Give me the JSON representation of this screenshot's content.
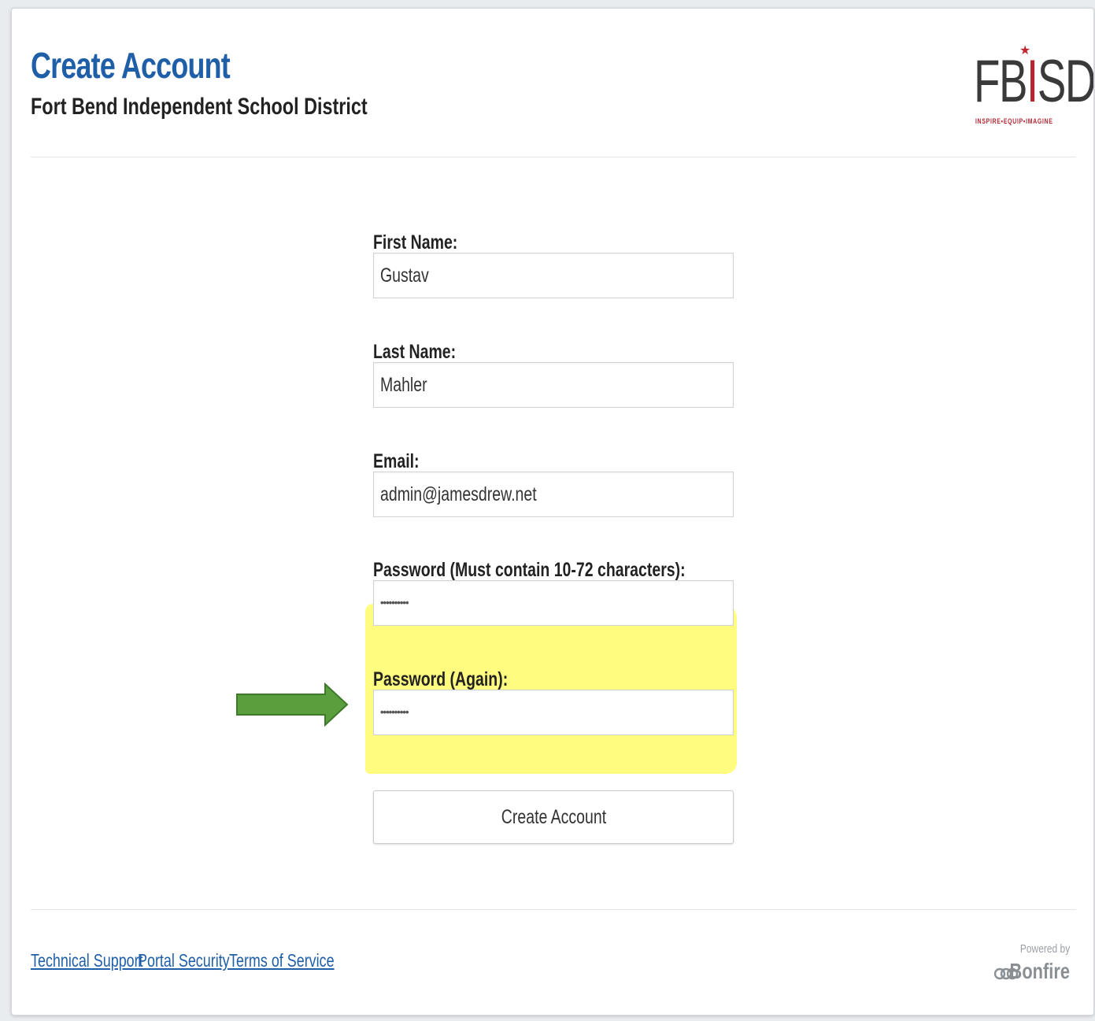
{
  "header": {
    "title": "Create Account",
    "subtitle": "Fort Bend Independent School District",
    "logo": {
      "letters_left": "FB",
      "letter_i": "I",
      "letters_right": "SD",
      "tagline": "INSPIRE•EQUIP•IMAGINE",
      "accent_color": "#b32631"
    }
  },
  "form": {
    "first_name": {
      "label": "First Name:",
      "value": "Gustav"
    },
    "last_name": {
      "label": "Last Name:",
      "value": "Mahler"
    },
    "email": {
      "label": "Email:",
      "value": "admin@jamesdrew.net"
    },
    "password": {
      "label": "Password (Must contain 10-72 characters):",
      "masked_value": "••••••••••"
    },
    "password_again": {
      "label": "Password (Again):",
      "masked_value": "••••••••••"
    },
    "submit_label": "Create Account"
  },
  "annotations": {
    "highlight_color": "#fff83c",
    "arrow_color": "#5a9e3e",
    "arrow_icon": "arrow-right-icon"
  },
  "footer": {
    "links": [
      "Technical Support",
      "Portal Security",
      "Terms of Service"
    ],
    "powered_by": "Powered by",
    "brand": "Bonfire",
    "brand_icon": "bonfire-logo-icon"
  }
}
